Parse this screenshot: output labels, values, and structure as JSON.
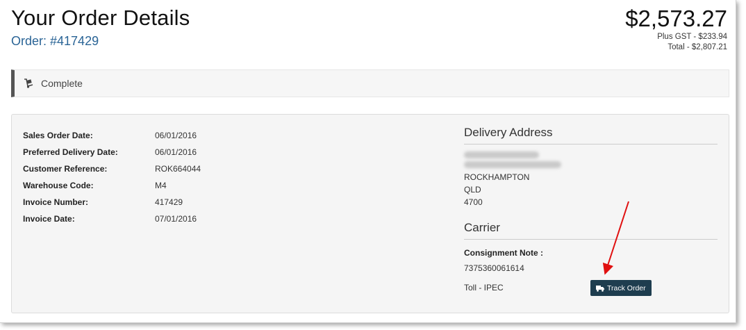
{
  "header": {
    "title": "Your Order Details",
    "order_label": "Order: #417429",
    "price": "$2,573.27",
    "gst": "Plus GST -  $233.94",
    "total": "Total - $2,807.21"
  },
  "status": {
    "icon": "dolly-icon",
    "label": "Complete"
  },
  "details": [
    {
      "label": "Sales Order Date:",
      "value": "06/01/2016"
    },
    {
      "label": "Preferred Delivery Date:",
      "value": "06/01/2016"
    },
    {
      "label": "Customer Reference:",
      "value": "ROK664044"
    },
    {
      "label": "Warehouse Code:",
      "value": "M4"
    },
    {
      "label": "Invoice Number:",
      "value": "417429"
    },
    {
      "label": "Invoice Date:",
      "value": "07/01/2016"
    }
  ],
  "delivery": {
    "title": "Delivery Address",
    "city": "ROCKHAMPTON",
    "state": "QLD",
    "postcode": "4700"
  },
  "carrier": {
    "title": "Carrier",
    "consignment_label": "Consignment Note :",
    "consignment_number": "7375360061614",
    "carrier_name": "Toll - IPEC",
    "track_label": "Track Order",
    "track_icon": "truck-icon"
  },
  "colors": {
    "accent_link": "#2a6496",
    "button_bg": "#1e3d4f",
    "arrow": "#e01010"
  }
}
